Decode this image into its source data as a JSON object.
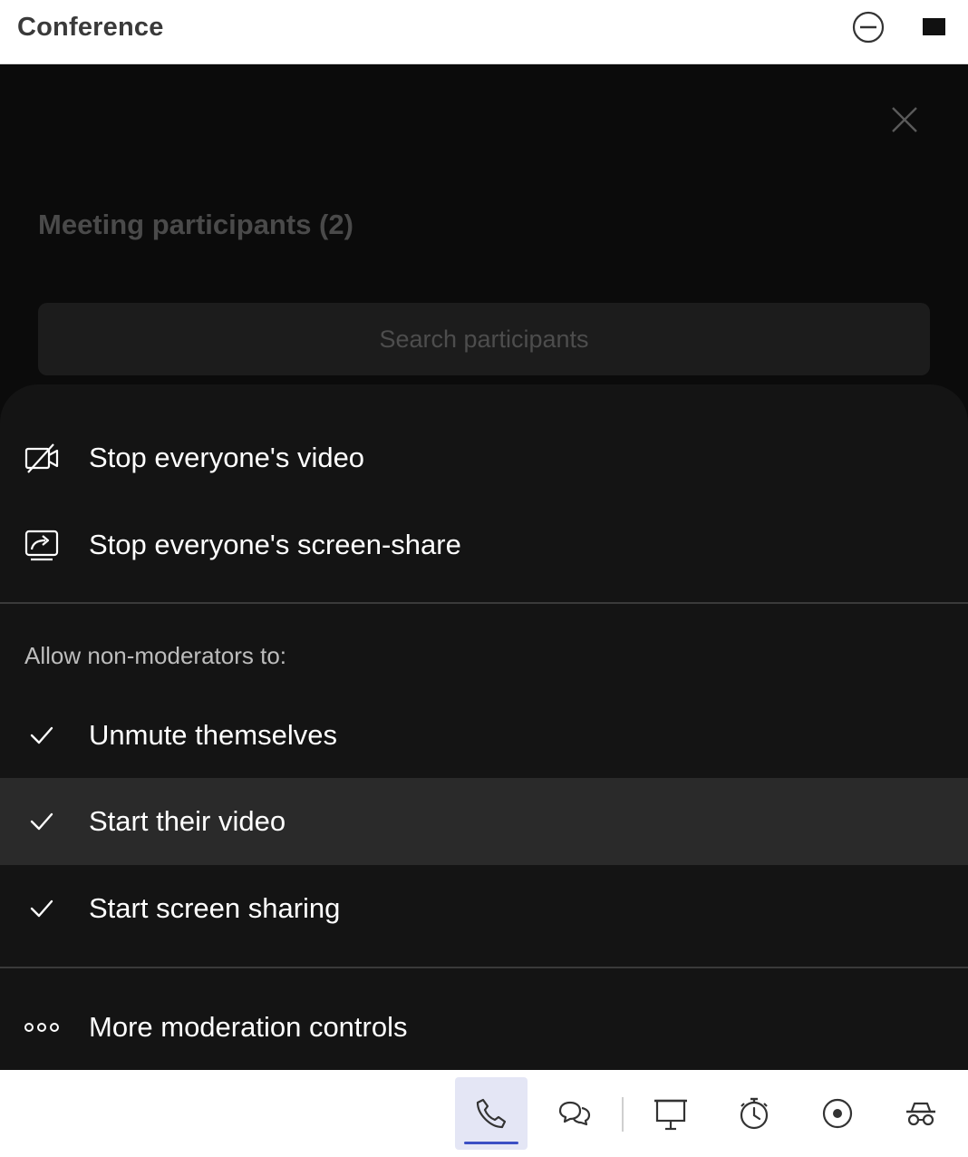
{
  "window": {
    "title": "Conference"
  },
  "panel": {
    "title": "Meeting participants (2)",
    "search_placeholder": "Search participants"
  },
  "menu": {
    "actions": [
      {
        "label": "Stop everyone's video",
        "icon": "video-off-icon"
      },
      {
        "label": "Stop everyone's screen-share",
        "icon": "screen-share-icon"
      }
    ],
    "section_label": "Allow non-moderators to:",
    "toggles": [
      {
        "label": "Unmute themselves",
        "checked": true
      },
      {
        "label": "Start their video",
        "checked": true,
        "highlighted": true
      },
      {
        "label": "Start screen sharing",
        "checked": true
      }
    ],
    "more_label": "More moderation controls"
  },
  "toolbar": {
    "items": [
      {
        "name": "call",
        "icon": "phone-icon",
        "active": true
      },
      {
        "name": "chat",
        "icon": "chat-icon"
      },
      {
        "name": "whiteboard",
        "icon": "presentation-icon"
      },
      {
        "name": "timer",
        "icon": "stopwatch-icon"
      },
      {
        "name": "record",
        "icon": "record-icon"
      },
      {
        "name": "incognito",
        "icon": "incognito-icon"
      }
    ]
  },
  "colors": {
    "accent": "#3b4fc4",
    "sheet_bg": "#141414",
    "highlight_row": "#2a2a2a"
  }
}
